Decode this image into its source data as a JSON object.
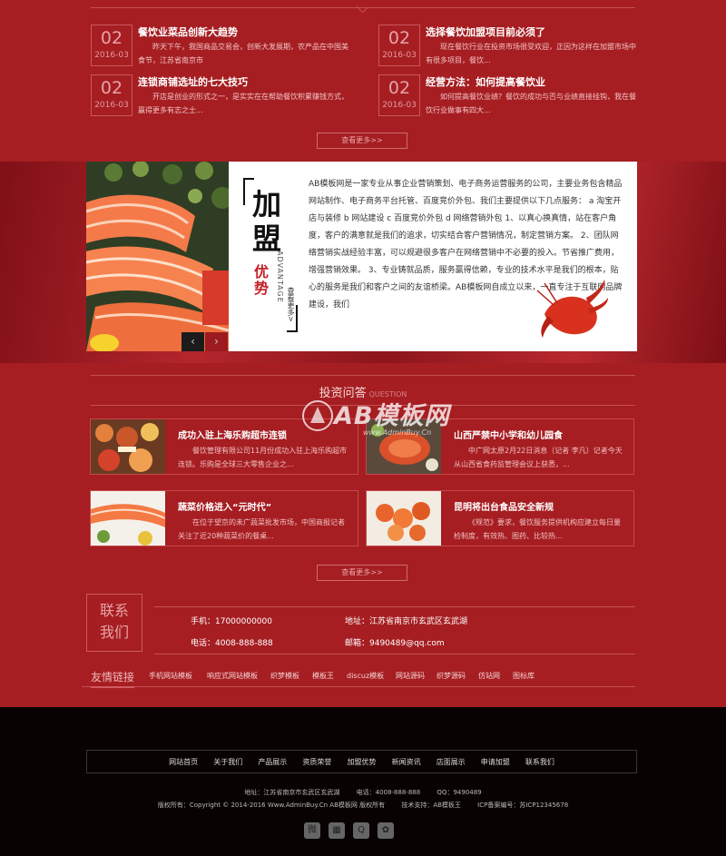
{
  "news": {
    "items": [
      {
        "day": "02",
        "ym": "2016-03",
        "title": "餐饮业菜品创新大趋势",
        "desc": "昨天下午，我国商品交易会，创新大发展期，农产品在中国美食节，江苏省南京市"
      },
      {
        "day": "02",
        "ym": "2016-03",
        "title": "选择餐饮加盟项目前必须了",
        "desc": "现在餐饮行业在投资市场很受欢迎，正因为这样在加盟市场中有很多项目，餐饮..."
      },
      {
        "day": "02",
        "ym": "2016-03",
        "title": "连锁商铺选址的七大技巧",
        "desc": "开店是创业的形式之一，是实实在在帮助餐饮积累赚钱方式，赢得更多有志之士..."
      },
      {
        "day": "02",
        "ym": "2016-03",
        "title": "经营方法：如何提高餐饮业",
        "desc": "如何提高餐饮业绩？餐饮的成功与否与业绩直接挂钩，我在餐饮行业做事有四大..."
      }
    ],
    "more_label": "查看更多>>"
  },
  "advantage": {
    "title_big": "加盟",
    "title_red": "优势",
    "title_en": "ADVANTAGE",
    "more_label": "查看更多>",
    "text": "AB模板网是一家专业从事企业营销策划、电子商务运营服务的公司，主要业务包含精品网站制作、电子商务平台托管、百度竞价外包、我们主要提供以下几点服务： a 淘宝开店与装修 b 网站建设 c 百度竞价外包 d 网络营销外包 1、以真心换真情，站在客户角度，客户的满意就是我们的追求，切实结合客户营销情况，制定营销方案。 2、团队网络营销实战经验丰富，可以规避很多客户在网络营销中不必要的投入。节省推广费用，增强营销效果。 3、专业铸就品质，服务赢得信赖，专业的技术水平是我们的根本，贴心的服务是我们和客户之间的友谊桥梁。AB模板网自成立以来，一直专注于互联网品牌建设，我们",
    "prev_icon": "‹",
    "next_icon": "›"
  },
  "qa": {
    "heading_cn": "投资问答",
    "heading_en": "QUESTION",
    "items": [
      {
        "title": "成功入驻上海乐购超市连锁",
        "desc": "餐饮管理有限公司11月份成功入驻上海乐购超市连锁。乐购是全球三大零售企业之..."
      },
      {
        "title": "山西严禁中小学和幼儿园食",
        "desc": "中广网太原2月22日消息（记者 李凡）记者今天从山西省食药监管理会议上获悉，..."
      },
      {
        "title": "蔬菜价格进入“元时代”",
        "desc": "在位于望京的未广蔬菜批发市场，中国商报记者关注了近20种蔬菜价的餐桌..."
      },
      {
        "title": "昆明将出台食品安全新规",
        "desc": "《规范》要求，餐饮服务提供机构应建立每日量检制度，有效热、图药、比较热..."
      }
    ],
    "more_label": "查看更多>>"
  },
  "watermark": {
    "brand": "AB模板网",
    "url": "www.AdminBuy.Cn"
  },
  "contact": {
    "title_line1": "联系",
    "title_line2": "我们",
    "phone": "手机：17000000000",
    "address": "地址：江苏省南京市玄武区玄武湖",
    "tel": "电话：4008-888-888",
    "email": "邮箱：9490489@qq.com"
  },
  "links": {
    "title": "友情链接",
    "items": [
      "手机网站模板",
      "响应式网站模板",
      "织梦模板",
      "模板王",
      "discuz模板",
      "网站源码",
      "织梦源码",
      "仿站网",
      "图标库"
    ]
  },
  "footer": {
    "nav": [
      "网站首页",
      "关于我们",
      "产品展示",
      "资质荣誉",
      "加盟优势",
      "新闻资讯",
      "店面展示",
      "申请加盟",
      "联系我们"
    ],
    "address": "地址：江苏省南京市玄武区玄武湖",
    "tel": "电话：4008-888-888",
    "qq": "QQ：9490489",
    "copyright": "版权所有：Copyright © 2014-2016 Www.AdminBuy.Cn AB模板网 版权所有",
    "tech": "技术支持：AB模板王",
    "icp": "ICP备案编号：苏ICP12345678",
    "social_icons": [
      "weibo-icon",
      "qrcode-icon",
      "qq-icon",
      "baidu-icon"
    ]
  }
}
